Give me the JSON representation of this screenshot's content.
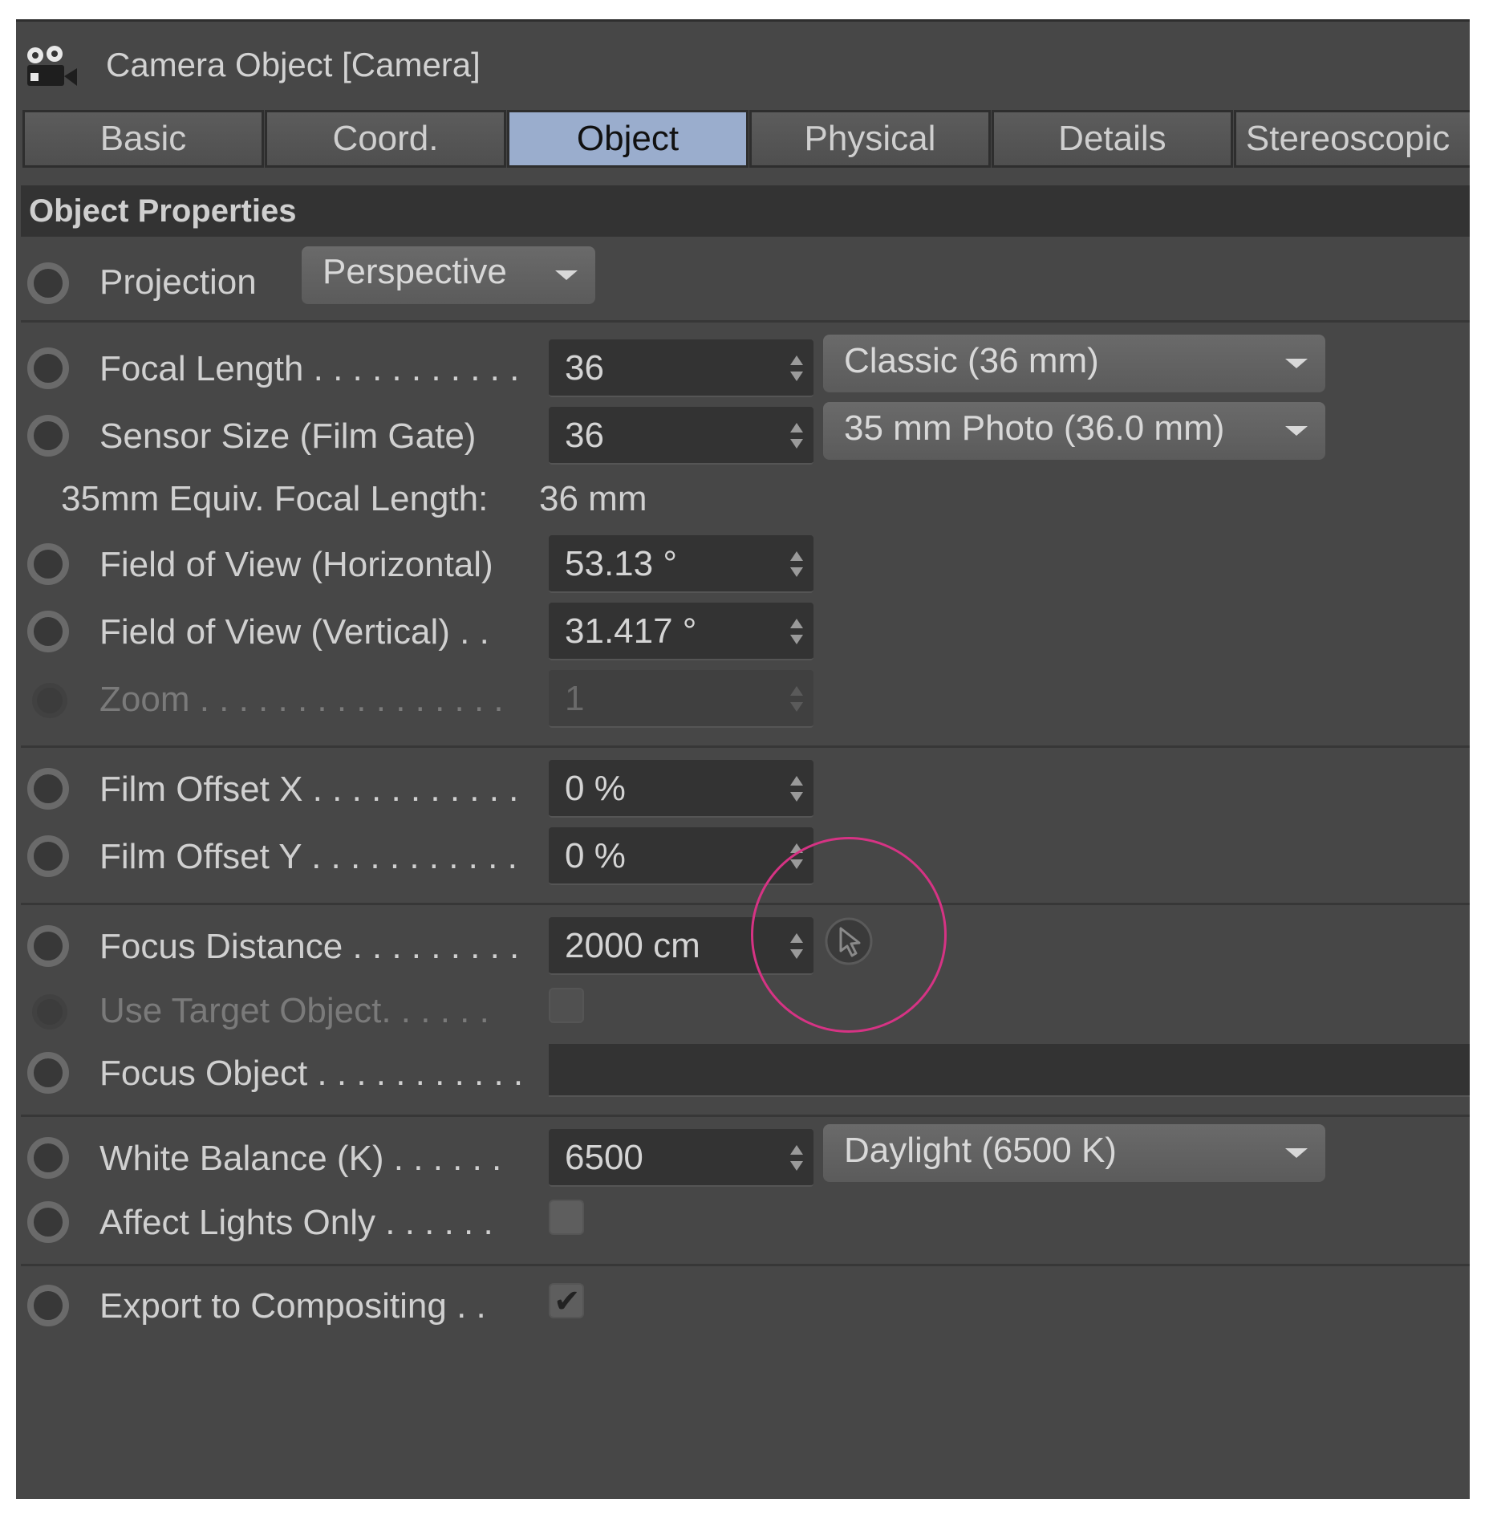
{
  "window": {
    "title": "Camera Object [Camera]"
  },
  "tabs": [
    {
      "label": "Basic",
      "active": false
    },
    {
      "label": "Coord.",
      "active": false
    },
    {
      "label": "Object",
      "active": true
    },
    {
      "label": "Physical",
      "active": false
    },
    {
      "label": "Details",
      "active": false
    },
    {
      "label": "Stereoscopic",
      "active": false
    }
  ],
  "section": {
    "title": "Object Properties"
  },
  "projection": {
    "label": "Projection",
    "value": "Perspective"
  },
  "focal_length": {
    "label": "Focal Length . . . . . . . . . . .",
    "value": "36",
    "preset": "Classic (36 mm)"
  },
  "sensor_size": {
    "label": "Sensor Size (Film Gate)",
    "value": "36",
    "preset": "35 mm Photo (36.0 mm)"
  },
  "equiv_focal": {
    "label": "35mm Equiv. Focal Length:",
    "value": "36 mm"
  },
  "fov_h": {
    "label": "Field of View (Horizontal)",
    "value": "53.13 °"
  },
  "fov_v": {
    "label": "Field of View (Vertical) . .",
    "value": "31.417 °"
  },
  "zoom": {
    "label": "Zoom . . . . . . . . . . . . . . . .",
    "value": "1",
    "enabled": false
  },
  "film_offset_x": {
    "label": "Film Offset X . . . . . . . . . . .",
    "value": "0 %"
  },
  "film_offset_y": {
    "label": "Film Offset Y . . . . . . . . . . .",
    "value": "0 %"
  },
  "focus_distance": {
    "label": "Focus Distance . . . . . . . . .",
    "value": "2000 cm",
    "pick_icon": "cursor-pick-icon"
  },
  "use_target": {
    "label": "Use Target Object. . . . . .",
    "checked": false,
    "enabled": false
  },
  "focus_object": {
    "label": "Focus Object . . . . . . . . . . .",
    "value": ""
  },
  "white_balance": {
    "label": "White Balance (K) . . . . . .",
    "value": "6500",
    "preset": "Daylight (6500 K)"
  },
  "affect_lights": {
    "label": "Affect Lights Only . . . . . .",
    "checked": false
  },
  "export_compositing": {
    "label": "Export to Compositing . .",
    "checked": true
  },
  "colors": {
    "panel_bg": "#474747",
    "active_tab": "#9aadcd",
    "highlight_circle": "#d63384"
  }
}
